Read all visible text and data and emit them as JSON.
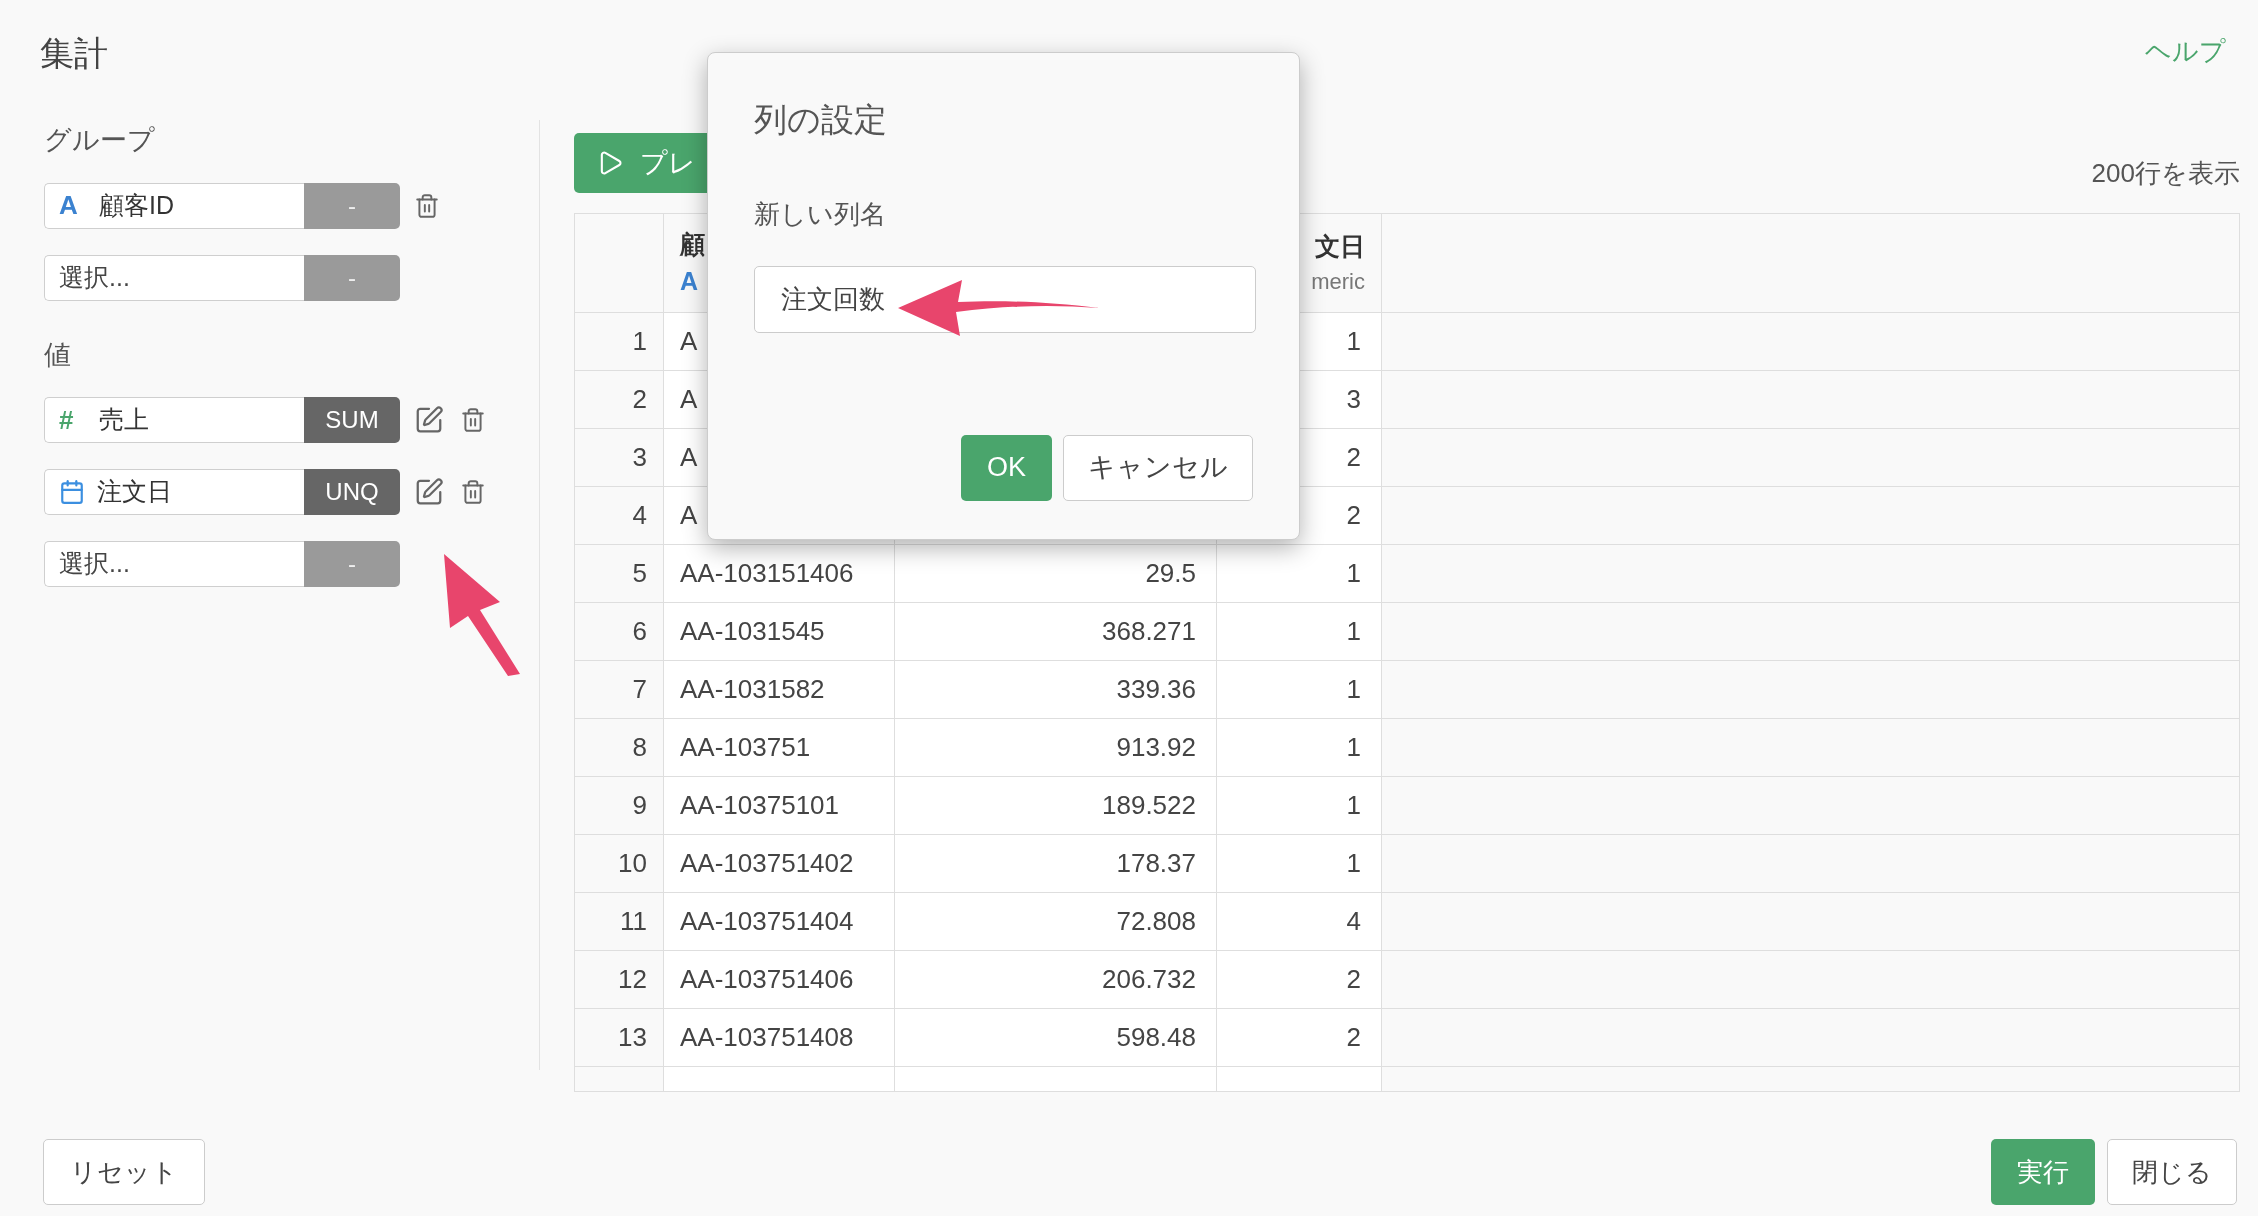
{
  "page": {
    "title": "集計",
    "help_link": "ヘルプ"
  },
  "sections": [
    {
      "label": "グループ",
      "fields": [
        {
          "kind": "text",
          "icon_text": "A",
          "name": "顧客ID",
          "agg": "-",
          "agg_set": false,
          "editable": false,
          "removable": true
        },
        {
          "kind": "empty",
          "placeholder": "選択...",
          "agg": "-",
          "agg_set": false,
          "editable": false,
          "removable": false
        }
      ]
    },
    {
      "label": "値",
      "fields": [
        {
          "kind": "number",
          "icon_text": "#",
          "name": "売上",
          "agg": "SUM",
          "agg_set": true,
          "editable": true,
          "removable": true
        },
        {
          "kind": "date",
          "name": "注文日",
          "agg": "UNQ",
          "agg_set": true,
          "editable": true,
          "removable": true
        },
        {
          "kind": "empty",
          "placeholder": "選択...",
          "agg": "-",
          "agg_set": false,
          "editable": false,
          "removable": false
        }
      ]
    }
  ],
  "preview_button": {
    "label": "プレ"
  },
  "row_count": "200行を表示",
  "table": {
    "columns": [
      {
        "label": "顧",
        "type_text": "A"
      },
      {
        "label": "文日",
        "type_text": "meric"
      }
    ],
    "rows": [
      {
        "index": "1",
        "id": "A",
        "orders": "1"
      },
      {
        "index": "2",
        "id": "A",
        "orders": "3"
      },
      {
        "index": "3",
        "id": "A",
        "orders": "2"
      },
      {
        "index": "4",
        "id": "A",
        "orders": "2"
      },
      {
        "index": "5",
        "id": "AA-103151406",
        "sales": "29.5",
        "orders": "1"
      },
      {
        "index": "6",
        "id": "AA-1031545",
        "sales": "368.271",
        "orders": "1"
      },
      {
        "index": "7",
        "id": "AA-1031582",
        "sales": "339.36",
        "orders": "1"
      },
      {
        "index": "8",
        "id": "AA-103751",
        "sales": "913.92",
        "orders": "1"
      },
      {
        "index": "9",
        "id": "AA-10375101",
        "sales": "189.522",
        "orders": "1"
      },
      {
        "index": "10",
        "id": "AA-103751402",
        "sales": "178.37",
        "orders": "1"
      },
      {
        "index": "11",
        "id": "AA-103751404",
        "sales": "72.808",
        "orders": "4"
      },
      {
        "index": "12",
        "id": "AA-103751406",
        "sales": "206.732",
        "orders": "2"
      },
      {
        "index": "13",
        "id": "AA-103751408",
        "sales": "598.48",
        "orders": "2"
      }
    ]
  },
  "dialog": {
    "title": "列の設定",
    "field_label": "新しい列名",
    "value": "注文回数",
    "ok": "OK",
    "cancel": "キャンセル"
  },
  "footer": {
    "reset": "リセット",
    "run": "実行",
    "close": "閉じる"
  }
}
